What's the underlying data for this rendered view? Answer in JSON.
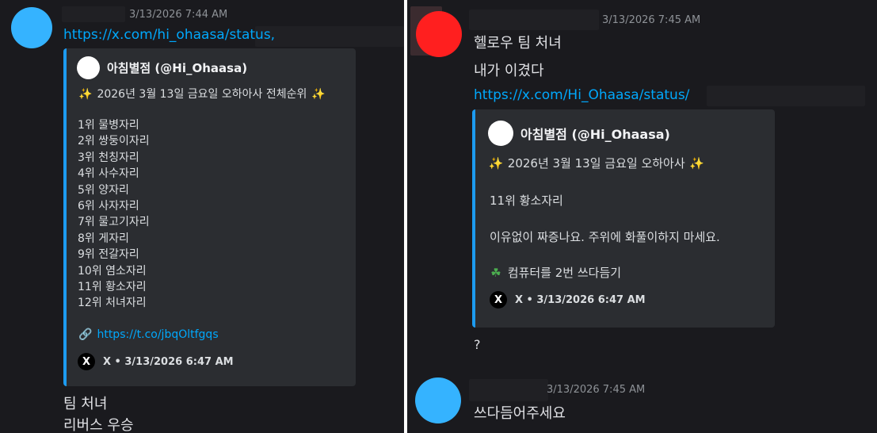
{
  "colors": {
    "background": "#1a1a1e",
    "link": "#00a8fc",
    "embed_bar": "#1d9bf0",
    "embed_bg": "#2b2d31",
    "avatar_blue": "#35b3ff",
    "avatar_red": "#ff1f1f"
  },
  "left": {
    "message": {
      "timestamp": "3/13/2026 7:44 AM",
      "link": "https://x.com/hi_ohaasa/status,",
      "embed": {
        "author": "아침별점 (@Hi_Ohaasa)",
        "headline_emoji": "✨",
        "headline": "2026년 3월 13일 금요일 오하아사 전체순위",
        "headline_emoji_end": "✨",
        "rankings": [
          "1위 물병자리",
          "2위 쌍둥이자리",
          "3위 천칭자리",
          "4위 사수자리",
          "5위 양자리",
          "6위 사자자리",
          "7위 물고기자리",
          "8위 게자리",
          "9위 전갈자리",
          "10위 염소자리",
          "11위 황소자리",
          "12위 처녀자리"
        ],
        "short_link_icon": "link-chain-icon",
        "short_link": "https://t.co/jbqOltfgqs",
        "footer_icon": "x-logo-icon",
        "footer_glyph": "X",
        "footer": "X • 3/13/2026 6:47 AM"
      },
      "follow_lines": [
        "팀 처녀",
        "리버스 우승"
      ]
    }
  },
  "right": {
    "message1": {
      "timestamp": "3/13/2026 7:45 AM",
      "lines": [
        "헬로우 팀 처녀",
        "내가 이겼다"
      ],
      "link": "https://x.com/Hi_Ohaasa/status/",
      "embed": {
        "author": "아침별점 (@Hi_Ohaasa)",
        "headline_emoji": "✨",
        "headline": "2026년 3월 13일 금요일 오하아사",
        "headline_emoji_end": "✨",
        "rank": "11위 황소자리",
        "fortune": "이유없이 짜증나요. 주위에 화풀이하지 마세요.",
        "lucky_emoji": "☘",
        "lucky": "컴퓨터를 2번 쓰다듬기",
        "footer_icon": "x-logo-icon",
        "footer_glyph": "X",
        "footer": "X • 3/13/2026 6:47 AM"
      },
      "follow_line": "?"
    },
    "message2": {
      "timestamp": "3/13/2026 7:45 AM",
      "text": "쓰다듬어주세요"
    }
  }
}
